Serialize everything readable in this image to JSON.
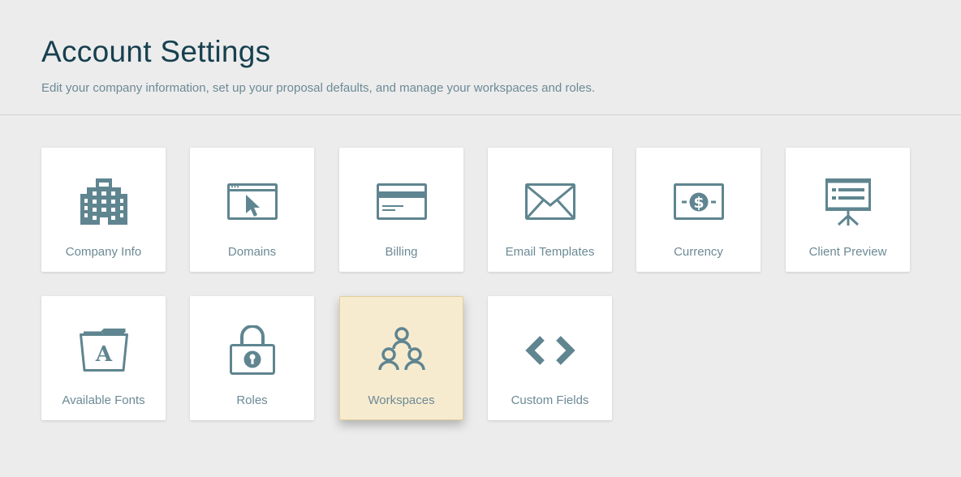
{
  "header": {
    "title": "Account Settings",
    "subtitle": "Edit your company information, set up your proposal defaults, and manage your workspaces and roles."
  },
  "colors": {
    "icon": "#5f8590",
    "tile_background": "#ffffff",
    "selected_tile_background": "#f7ebcf",
    "page_background": "#ececec",
    "title_text": "#17404f",
    "label_text": "#6c8a96"
  },
  "tiles": [
    {
      "label": "Company Info",
      "icon": "building-icon"
    },
    {
      "label": "Domains",
      "icon": "browser-cursor-icon"
    },
    {
      "label": "Billing",
      "icon": "credit-card-icon"
    },
    {
      "label": "Email Templates",
      "icon": "envelope-icon"
    },
    {
      "label": "Currency",
      "icon": "dollar-bill-icon"
    },
    {
      "label": "Client Preview",
      "icon": "presentation-board-icon"
    },
    {
      "label": "Available Fonts",
      "icon": "font-folder-icon"
    },
    {
      "label": "Roles",
      "icon": "padlock-icon"
    },
    {
      "label": "Workspaces",
      "icon": "people-group-icon",
      "selected": true
    },
    {
      "label": "Custom Fields",
      "icon": "code-brackets-icon"
    }
  ],
  "currency_symbol": "$",
  "font_sample_letter": "A"
}
